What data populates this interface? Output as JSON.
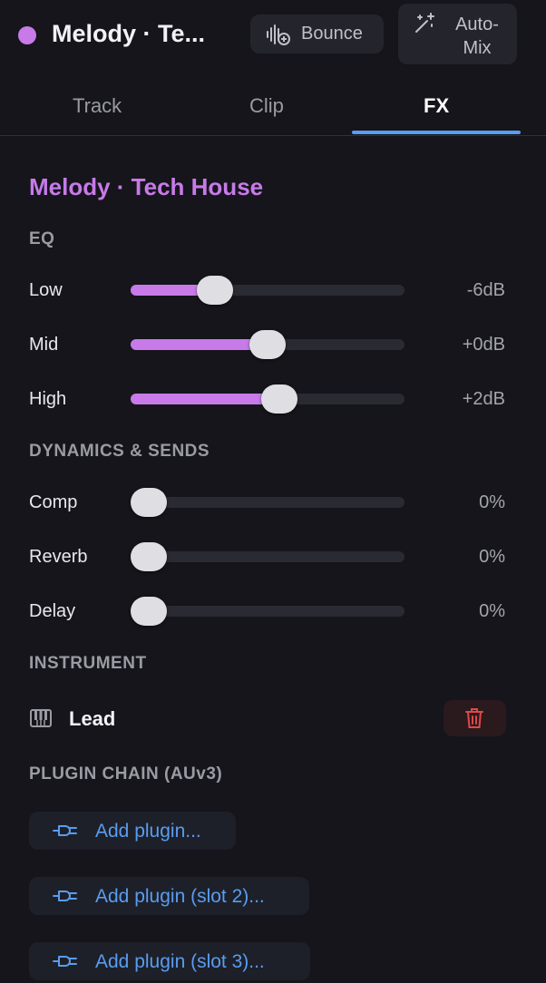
{
  "header": {
    "title": "Melody · Te...",
    "dot_color": "#c77ae8",
    "bounce_label": "Bounce",
    "bounce_icon": "waveform-add-icon",
    "automix_label_line1": "Auto-",
    "automix_label_line2": "Mix",
    "automix_icon": "magic-wand-icon"
  },
  "tabs": [
    {
      "label": "Track",
      "active": false
    },
    {
      "label": "Clip",
      "active": false
    },
    {
      "label": "FX",
      "active": true
    }
  ],
  "section": {
    "title": "Melody · Tech House"
  },
  "eq": {
    "label": "EQ",
    "rows": [
      {
        "label": "Low",
        "value": "-6dB",
        "level": 0.28
      },
      {
        "label": "Mid",
        "value": "+0dB",
        "level": 0.5
      },
      {
        "label": "High",
        "value": "+2dB",
        "level": 0.55
      }
    ]
  },
  "dynamics": {
    "label": "DYNAMICS & SENDS",
    "rows": [
      {
        "label": "Comp",
        "value": "0%",
        "level": 0
      },
      {
        "label": "Reverb",
        "value": "0%",
        "level": 0
      },
      {
        "label": "Delay",
        "value": "0%",
        "level": 0
      }
    ]
  },
  "instrument": {
    "label": "INSTRUMENT",
    "name": "Lead",
    "icon": "piano-keys-icon",
    "delete_icon": "trash-icon"
  },
  "plugins": {
    "label": "PLUGIN CHAIN (AUv3)",
    "items": [
      {
        "label": "Add plugin..."
      },
      {
        "label": "Add plugin (slot 2)..."
      },
      {
        "label": "Add plugin (slot 3)..."
      }
    ]
  },
  "colors": {
    "accent": "#c77ae8",
    "link": "#5a9cf0",
    "danger": "#e04848",
    "background": "#15151b"
  }
}
